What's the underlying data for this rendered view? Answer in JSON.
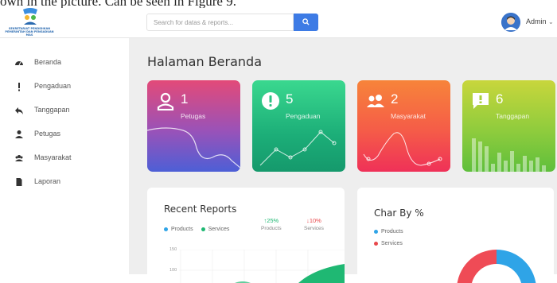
{
  "caption": "own in the picture. Can be seen in Figure 9.",
  "logo": {
    "text": "SEKRETARIAT PENDIDIKAN PEMERINTAH DAN PENGADUAN MAS"
  },
  "search": {
    "placeholder": "Search for datas & reports..."
  },
  "user": {
    "name": "Admin"
  },
  "sidebar": {
    "items": [
      {
        "label": "Beranda",
        "icon": "tachometer-icon"
      },
      {
        "label": "Pengaduan",
        "icon": "exclamation-icon"
      },
      {
        "label": "Tanggapan",
        "icon": "reply-icon"
      },
      {
        "label": "Petugas",
        "icon": "user-icon"
      },
      {
        "label": "Masyarakat",
        "icon": "users-icon"
      },
      {
        "label": "Laporan",
        "icon": "file-icon"
      }
    ]
  },
  "page": {
    "title": "Halaman Beranda"
  },
  "cards": [
    {
      "value": "1",
      "label": "Petugas",
      "icon": "user-icon",
      "gradient": [
        "#e34a78",
        "#4d5fd6"
      ]
    },
    {
      "value": "5",
      "label": "Pengaduan",
      "icon": "exclamation-circle-icon",
      "gradient": [
        "#35d38b",
        "#17a474"
      ]
    },
    {
      "value": "2",
      "label": "Masyarakat",
      "icon": "users-icon",
      "gradient": [
        "#f7843a",
        "#f2385a"
      ]
    },
    {
      "value": "6",
      "label": "Tanggapan",
      "icon": "comment-icon",
      "gradient": [
        "#c3d33a",
        "#5fbf3c"
      ]
    }
  ],
  "recent_reports": {
    "title": "Recent Reports",
    "legend": [
      {
        "label": "Products",
        "color": "#2fa4e7"
      },
      {
        "label": "Services",
        "color": "#1fb873"
      }
    ],
    "stats": [
      {
        "value": "↑25%",
        "label": "Products",
        "color": "#1fb873"
      },
      {
        "value": "↓10%",
        "label": "Services",
        "color": "#e8484b"
      }
    ],
    "yticks": [
      "150",
      "100"
    ]
  },
  "char_by": {
    "title": "Char By %",
    "legend": [
      {
        "label": "Products",
        "color": "#2fa4e7"
      },
      {
        "label": "Services",
        "color": "#e8484b"
      }
    ]
  }
}
